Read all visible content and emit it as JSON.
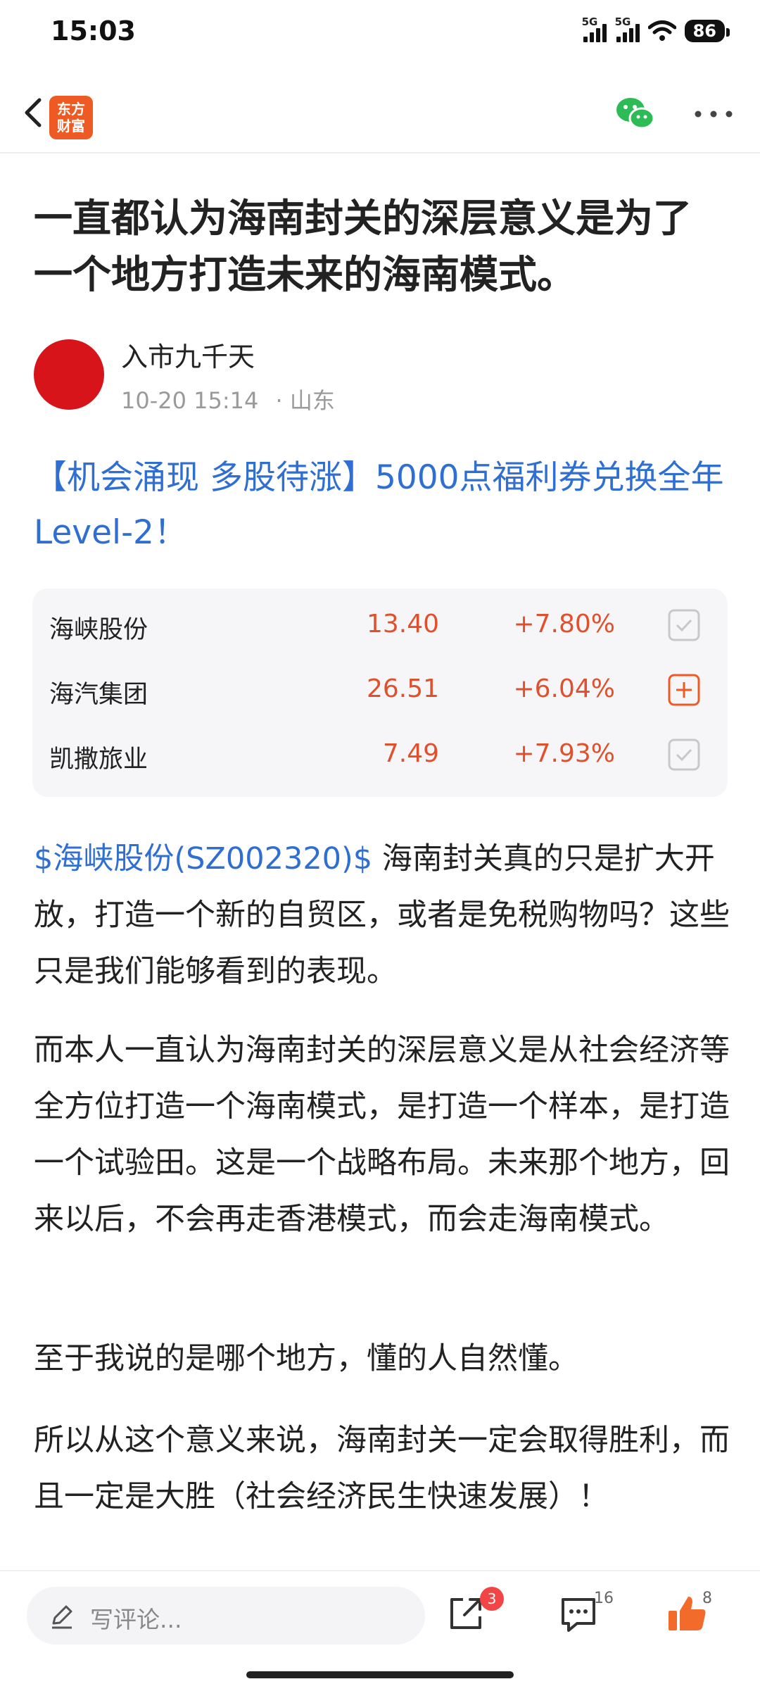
{
  "status_bar": {
    "time": "15:03",
    "signal1": "5G",
    "signal2": "5G",
    "battery": "86"
  },
  "nav": {
    "logo_line1": "东方",
    "logo_line2": "财富",
    "logo_color": "#ee5a24",
    "wechat_icon": "wechat-icon",
    "more_icon": "more-icon"
  },
  "article": {
    "title": "一直都认为海南封关的深层意义是为了一个地方打造未来的海南模式。",
    "author": "入市九千天",
    "date": "10-20 15:14",
    "location": "· 山东",
    "promo": "【机会涌现 多股待涨】5000点福利券兑换全年Level-2！",
    "stocks": [
      {
        "name": "海峡股份",
        "price": "13.40",
        "change": "+7.80%",
        "action": "check"
      },
      {
        "name": "海汽集团",
        "price": "26.51",
        "change": "+6.04%",
        "action": "add"
      },
      {
        "name": "凯撒旅业",
        "price": "7.49",
        "change": "+7.93%",
        "action": "check"
      }
    ],
    "p1_tag": "$海峡股份(SZ002320)$",
    "p1_text": " 海南封关真的只是扩大开放，打造一个新的自贸区，或者是免税购物吗？这些只是我们能够看到的表现。",
    "p2": "而本人一直认为海南封关的深层意义是从社会经济等全方位打造一个海南模式，是打造一个样本，是打造一个试验田。这是一个战略布局。未来那个地方，回来以后，不会再走香港模式，而会走海南模式。",
    "p3": "至于我说的是哪个地方，懂的人自然懂。",
    "p4": "所以从这个意义来说，海南封关一定会取得胜利，而且一定是大胜（社会经济民生快速发展）！"
  },
  "bottom_bar": {
    "comment_placeholder": "写评论...",
    "share_badge": "3",
    "comment_count": "16",
    "like_count": "8",
    "accent": "#f24545",
    "like_color": "#f26b2a"
  }
}
